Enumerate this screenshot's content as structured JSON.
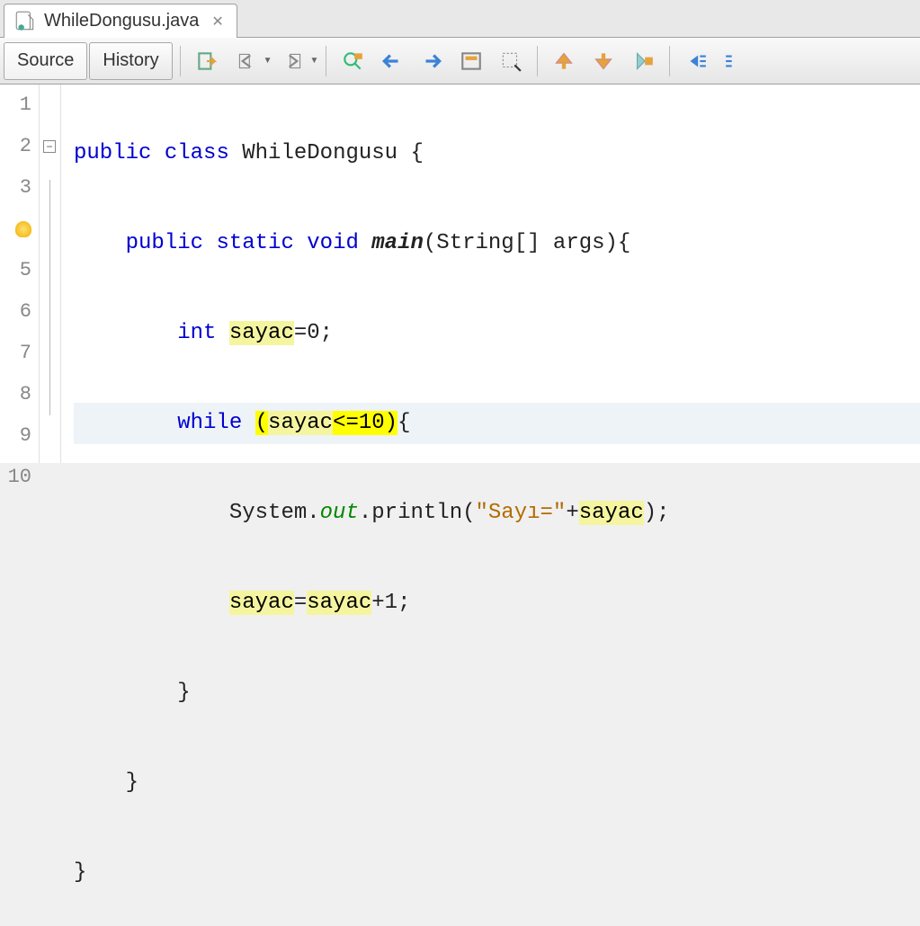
{
  "tab": {
    "filename": "WhileDongusu.java"
  },
  "toolbar": {
    "source_label": "Source",
    "history_label": "History"
  },
  "gutter": {
    "lines": [
      "1",
      "2",
      "3",
      "",
      "5",
      "6",
      "7",
      "8",
      "9",
      "10"
    ]
  },
  "code": {
    "line1": {
      "kw1": "public",
      "kw2": "class",
      "name": "WhileDongusu",
      "brace": "{"
    },
    "line2": {
      "kw1": "public",
      "kw2": "static",
      "kw3": "void",
      "fn": "main",
      "params": "(String[] args){"
    },
    "line3": {
      "kw1": "int",
      "var": "sayac",
      "rest": "=0;"
    },
    "line4": {
      "kw1": "while",
      "cond_open": "(",
      "cond_var": "sayac",
      "cond_rest": "<=10)",
      "brace": "{"
    },
    "line5": {
      "prefix": "System.",
      "field": "out",
      "mid": ".println(",
      "str": "\"Sayı=\"",
      "plus": "+",
      "var": "sayac",
      "end": ");"
    },
    "line6": {
      "var1": "sayac",
      "eq": "=",
      "var2": "sayac",
      "rest": "+1;"
    },
    "line7": {
      "brace": "}"
    },
    "line8": {
      "brace": "}"
    },
    "line9": {
      "brace": "}"
    }
  }
}
